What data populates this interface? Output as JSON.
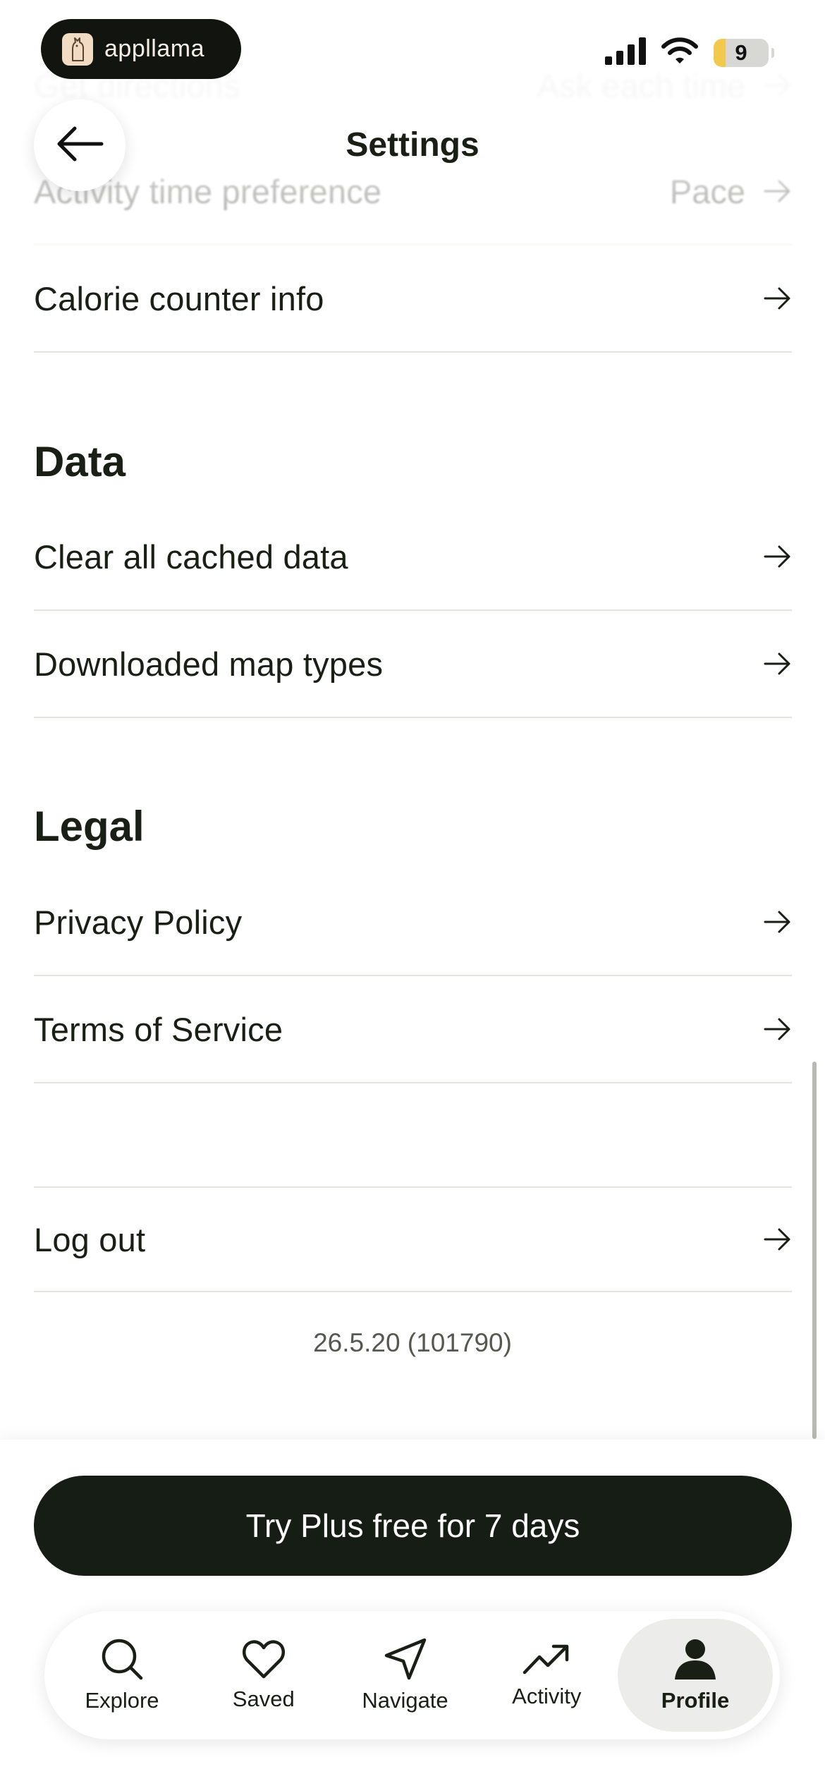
{
  "status_bar": {
    "app_brand": "appllama",
    "battery_level": "9"
  },
  "header": {
    "title": "Settings",
    "back_icon": "arrow-left-icon"
  },
  "rows_top": [
    {
      "label": "Get directions",
      "value": "Ask each time"
    },
    {
      "label": "Activity time preference",
      "value": "Pace"
    },
    {
      "label": "Calorie counter info",
      "value": ""
    }
  ],
  "data_section": {
    "title": "Data",
    "items": [
      {
        "label": "Clear all cached data"
      },
      {
        "label": "Downloaded map types"
      }
    ]
  },
  "legal_section": {
    "title": "Legal",
    "items": [
      {
        "label": "Privacy Policy"
      },
      {
        "label": "Terms of Service"
      }
    ]
  },
  "logout_label": "Log out",
  "version": "26.5.20 (101790)",
  "cta_label": "Try Plus free for 7 days",
  "tabs": [
    {
      "label": "Explore",
      "icon": "search-icon"
    },
    {
      "label": "Saved",
      "icon": "heart-icon"
    },
    {
      "label": "Navigate",
      "icon": "navigate-arrow-icon"
    },
    {
      "label": "Activity",
      "icon": "trending-up-icon"
    },
    {
      "label": "Profile",
      "icon": "person-icon",
      "active": true
    }
  ],
  "colors": {
    "text": "#1a1f16",
    "cta_bg": "#161d14",
    "divider": "#e3e3e0",
    "active_tab_bg": "#ececea",
    "battery_accent": "#f2c94c"
  }
}
